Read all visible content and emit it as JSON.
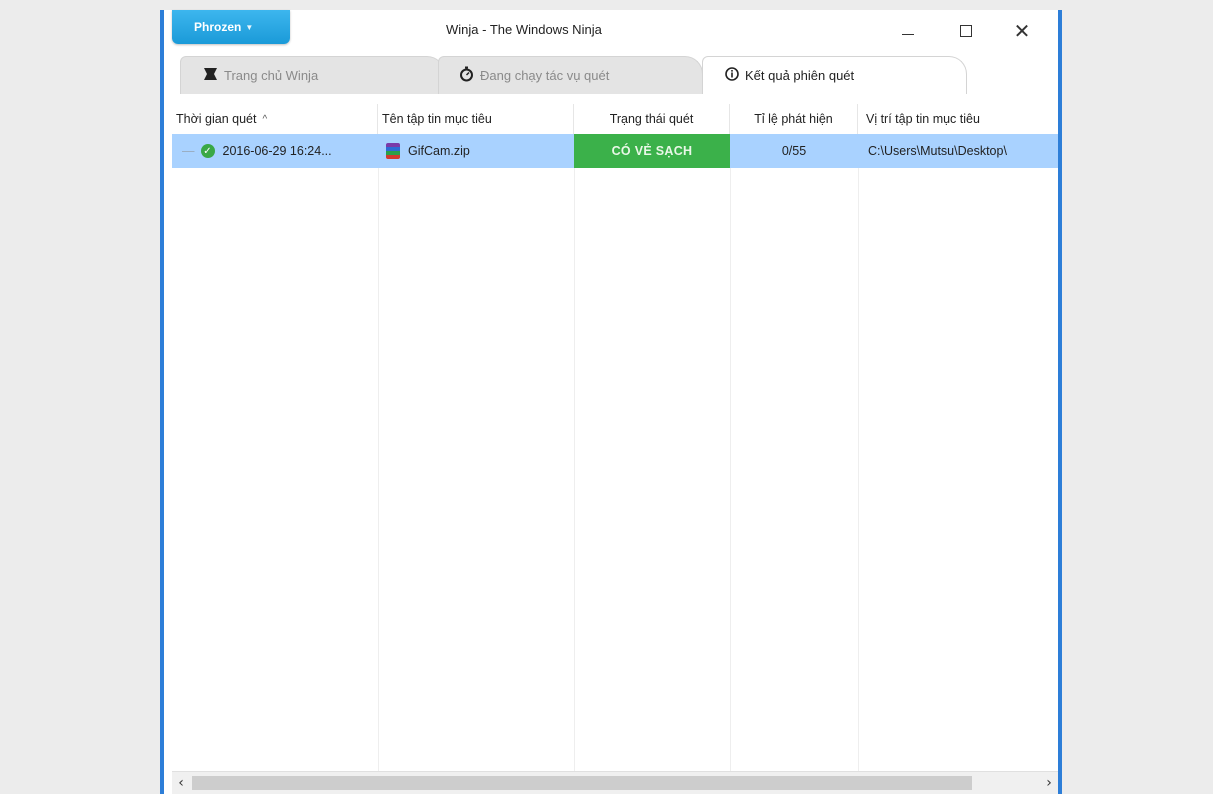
{
  "window": {
    "title": "Winja - The Windows Ninja",
    "brand_button": "Phrozen",
    "controls": {
      "minimize_icon": "minimize-icon",
      "maximize_icon": "maximize-icon",
      "close_icon": "close-icon",
      "close_glyph": "✕"
    },
    "border_color": "#2d7ed8"
  },
  "tabs": [
    {
      "label": "Trang chủ Winja",
      "icon": "ninja-star-icon",
      "active": false
    },
    {
      "label": "Đang chạy tác vụ quét",
      "icon": "stopwatch-icon",
      "active": false
    },
    {
      "label": "Kết quả phiên quét",
      "icon": "info-icon",
      "active": true
    }
  ],
  "table": {
    "columns": [
      {
        "label": "Thời gian quét",
        "sort": "^"
      },
      {
        "label": "Tên tập tin mục tiêu"
      },
      {
        "label": "Trạng thái quét"
      },
      {
        "label": "Tỉ lệ phát hiện"
      },
      {
        "label": "Vị trí tập tin mục tiêu"
      }
    ],
    "rows": [
      {
        "time": "2016-06-29 16:24...",
        "file": "GifCam.zip",
        "status": "CÓ VẺ SẠCH",
        "detection": "0/55",
        "path": "C:\\Users\\Mutsu\\Desktop\\"
      }
    ],
    "selected_row_color": "#a9d2ff",
    "status_color": "#3bb14a"
  },
  "scrollbar": {
    "left_glyph": "‹",
    "right_glyph": "›"
  }
}
